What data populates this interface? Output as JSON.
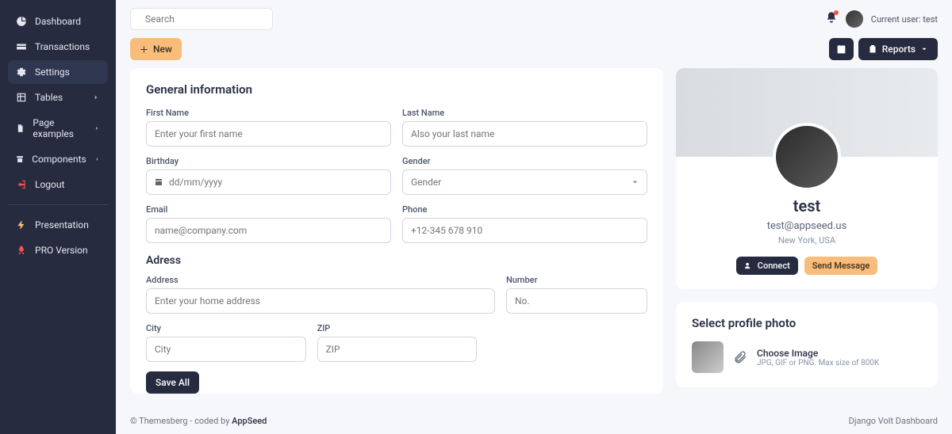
{
  "sidebar": {
    "items": [
      {
        "label": "Dashboard"
      },
      {
        "label": "Transactions"
      },
      {
        "label": "Settings"
      },
      {
        "label": "Tables"
      },
      {
        "label": "Page examples"
      },
      {
        "label": "Components"
      },
      {
        "label": "Logout"
      }
    ],
    "extra": [
      {
        "label": "Presentation"
      },
      {
        "label": "PRO Version"
      }
    ]
  },
  "topbar": {
    "search_placeholder": "Search",
    "user_label": "Current user: test"
  },
  "actionbar": {
    "new_label": "New",
    "reports_label": "Reports"
  },
  "form": {
    "general_title": "General information",
    "first_name_label": "First Name",
    "first_name_placeholder": "Enter your first name",
    "last_name_label": "Last Name",
    "last_name_placeholder": "Also your last name",
    "birthday_label": "Birthday",
    "birthday_placeholder": "dd/mm/yyyy",
    "gender_label": "Gender",
    "gender_placeholder": "Gender",
    "email_label": "Email",
    "email_placeholder": "name@company.com",
    "phone_label": "Phone",
    "phone_placeholder": "+12-345 678 910",
    "address_title": "Adress",
    "address_label": "Address",
    "address_placeholder": "Enter your home address",
    "number_label": "Number",
    "number_placeholder": "No.",
    "city_label": "City",
    "city_placeholder": "City",
    "zip_label": "ZIP",
    "zip_placeholder": "ZIP",
    "save_label": "Save All"
  },
  "profile": {
    "name": "test",
    "email": "test@appseed.us",
    "location": "New York, USA",
    "connect_label": "Connect",
    "send_label": "Send Message"
  },
  "upload": {
    "title": "Select profile photo",
    "choose": "Choose Image",
    "hint": "JPG, GIF or PNG. Max size of 800K"
  },
  "footer": {
    "left_pre": "© Themesberg - coded by ",
    "left_link": "AppSeed",
    "right": "Django Volt Dashboard"
  }
}
